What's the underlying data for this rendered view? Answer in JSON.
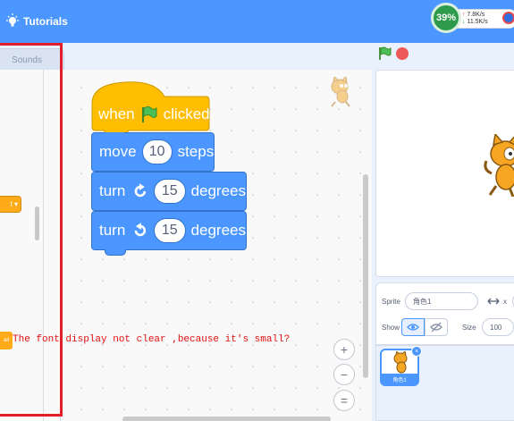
{
  "menubar": {
    "tutorials_label": "Tutorials"
  },
  "net_widget": {
    "cpu_percent": "39%",
    "upload": "7.8K/s",
    "download": "11.5K/s",
    "up_arrow": "↑",
    "down_arrow": "↓"
  },
  "tabs": {
    "sounds_label": "Sounds"
  },
  "palette": {
    "orange_block_label": "t",
    "orange_block_caret": "▾",
    "orange_small_label": "all"
  },
  "script": {
    "hat": {
      "prefix": "when",
      "suffix": "clicked"
    },
    "move": {
      "label": "move",
      "value": "10",
      "unit": "steps"
    },
    "turn_right": {
      "label": "turn",
      "value": "15",
      "unit": "degrees"
    },
    "turn_left": {
      "label": "turn",
      "value": "15",
      "unit": "degrees"
    }
  },
  "annotation": "The font display not clear ,because it's small?",
  "zoom": {
    "in": "+",
    "out": "−",
    "reset": "="
  },
  "sprite_info": {
    "sprite_label": "Sprite",
    "sprite_name": "角色1",
    "x_label": "x",
    "show_label": "Show",
    "size_label": "Size",
    "size_value": "100"
  },
  "sprite_list": {
    "tile_name": "角色1",
    "delete_glyph": "×"
  },
  "colors": {
    "motion": "#4c97ff",
    "events": "#ffbf00",
    "menubar": "#4c97ff",
    "highlight": "#e31d2a"
  }
}
